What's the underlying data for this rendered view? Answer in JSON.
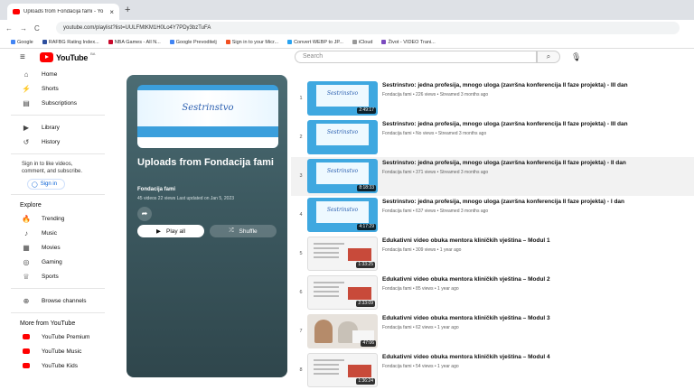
{
  "browser": {
    "tab_title": "Uploads from Fondacija fami - Yo",
    "tab_close": "×",
    "new_tab": "+",
    "nav": [
      "←",
      "→",
      "C"
    ],
    "url": "youtube.com/playlist?list=UULFMtKM1H0Lo4Y7PDy3bzTuFA",
    "bookmarks": [
      {
        "label": "Google",
        "color": "#4285f4"
      },
      {
        "label": "RAFBG Rating Index...",
        "color": "#2d4f9e"
      },
      {
        "label": "NBA Games - All N...",
        "color": "#c9082a"
      },
      {
        "label": "Google Prevoditelj",
        "color": "#4285f4"
      },
      {
        "label": "Sign in to your Micr...",
        "color": "#f25022"
      },
      {
        "label": "Convert WEBP to JP...",
        "color": "#2aa3f0"
      },
      {
        "label": "iCloud",
        "color": "#999999"
      },
      {
        "label": "Život - VIDEO Trani...",
        "color": "#7b4bbf"
      }
    ]
  },
  "header": {
    "menu_icon": "hamburger-icon",
    "logo_text": "YouTube",
    "logo_cc": "BA",
    "search_placeholder": "Search",
    "search_icon": "⌕",
    "mic_icon": "🎙"
  },
  "sidebar": {
    "main": [
      {
        "label": "Home",
        "icon": "⌂",
        "icon_name": "home-icon"
      },
      {
        "label": "Shorts",
        "icon": "⚡",
        "icon_name": "shorts-icon"
      },
      {
        "label": "Subscriptions",
        "icon": "▤",
        "icon_name": "subscriptions-icon"
      }
    ],
    "you": [
      {
        "label": "Library",
        "icon": "▶",
        "icon_name": "library-icon"
      },
      {
        "label": "History",
        "icon": "↺",
        "icon_name": "history-icon"
      }
    ],
    "signin_text": "Sign in to like videos, comment, and subscribe.",
    "signin_button": "Sign in",
    "explore_title": "Explore",
    "explore": [
      {
        "label": "Trending",
        "icon": "🔥",
        "icon_name": "trending-icon"
      },
      {
        "label": "Music",
        "icon": "♪",
        "icon_name": "music-icon"
      },
      {
        "label": "Movies",
        "icon": "▦",
        "icon_name": "movies-icon"
      },
      {
        "label": "Gaming",
        "icon": "◎",
        "icon_name": "gaming-icon"
      },
      {
        "label": "Sports",
        "icon": "♕",
        "icon_name": "sports-icon"
      }
    ],
    "browse_channels": "Browse channels",
    "more_title": "More from YouTube",
    "more": [
      {
        "label": "YouTube Premium"
      },
      {
        "label": "YouTube Music"
      },
      {
        "label": "YouTube Kids"
      }
    ],
    "red": "#ff0000"
  },
  "playlist": {
    "thumb_text": "Sestrinstvo",
    "title": "Uploads from Fondacija fami",
    "owner": "Fondacija fami",
    "meta": "45 videos  22 views  Last updated on Jan 5, 2023",
    "play_all": "Play all",
    "shuffle": "Shuffle"
  },
  "videos": [
    {
      "index": "1",
      "title": "Sestrinstvo: jedna profesija, mnogo uloga (završna konferencija II faze projekta) - III dan",
      "meta": "Fondacija fami • 226 views • Streamed 3 months ago",
      "duration": "2:49:17",
      "thumb": "blue",
      "thumb_text": "Sestrinstvo",
      "highlighted": false
    },
    {
      "index": "2",
      "title": "Sestrinstvo: jedna profesija, mnogo uloga (završna konferencija II faze projekta) - III dan",
      "meta": "Fondacija fami • No views • Streamed 3 months ago",
      "duration": "",
      "thumb": "blue",
      "thumb_text": "Sestrinstvo",
      "highlighted": false
    },
    {
      "index": "3",
      "title": "Sestrinstvo: jedna profesija, mnogo uloga (završna konferencija II faze projekta) - II dan",
      "meta": "Fondacija fami • 371 views • Streamed 3 months ago",
      "duration": "8:18:33",
      "thumb": "blue",
      "thumb_text": "Sestrinstvo",
      "highlighted": true
    },
    {
      "index": "4",
      "title": "Sestrinstvo: jedna profesija, mnogo uloga (završna konferencija II faze projekta) - I dan",
      "meta": "Fondacija fami • 637 views • Streamed 3 months ago",
      "duration": "4:17:29",
      "thumb": "blue",
      "thumb_text": "Sestrinstvo",
      "highlighted": false
    },
    {
      "index": "5",
      "title": "Edukativni video obuka mentora kliničkih vještina – Modul 1",
      "meta": "Fondacija fami • 309 views • 1 year ago",
      "duration": "1:33:25",
      "thumb": "white",
      "highlighted": false
    },
    {
      "index": "6",
      "title": "Edukativni video obuka mentora kliničkih vještina – Modul 2",
      "meta": "Fondacija fami • 85 views • 1 year ago",
      "duration": "2:33:09",
      "thumb": "white",
      "highlighted": false
    },
    {
      "index": "7",
      "title": "Edukativni video obuka mentora kliničkih vještina – Modul 3",
      "meta": "Fondacija fami • 62 views • 1 year ago",
      "duration": "47:06",
      "thumb": "photo",
      "highlighted": false
    },
    {
      "index": "8",
      "title": "Edukativni video obuka mentora kliničkih vještina – Modul 4",
      "meta": "Fondacija fami • 54 views • 1 year ago",
      "duration": "1:36:24",
      "thumb": "white",
      "highlighted": false
    }
  ]
}
